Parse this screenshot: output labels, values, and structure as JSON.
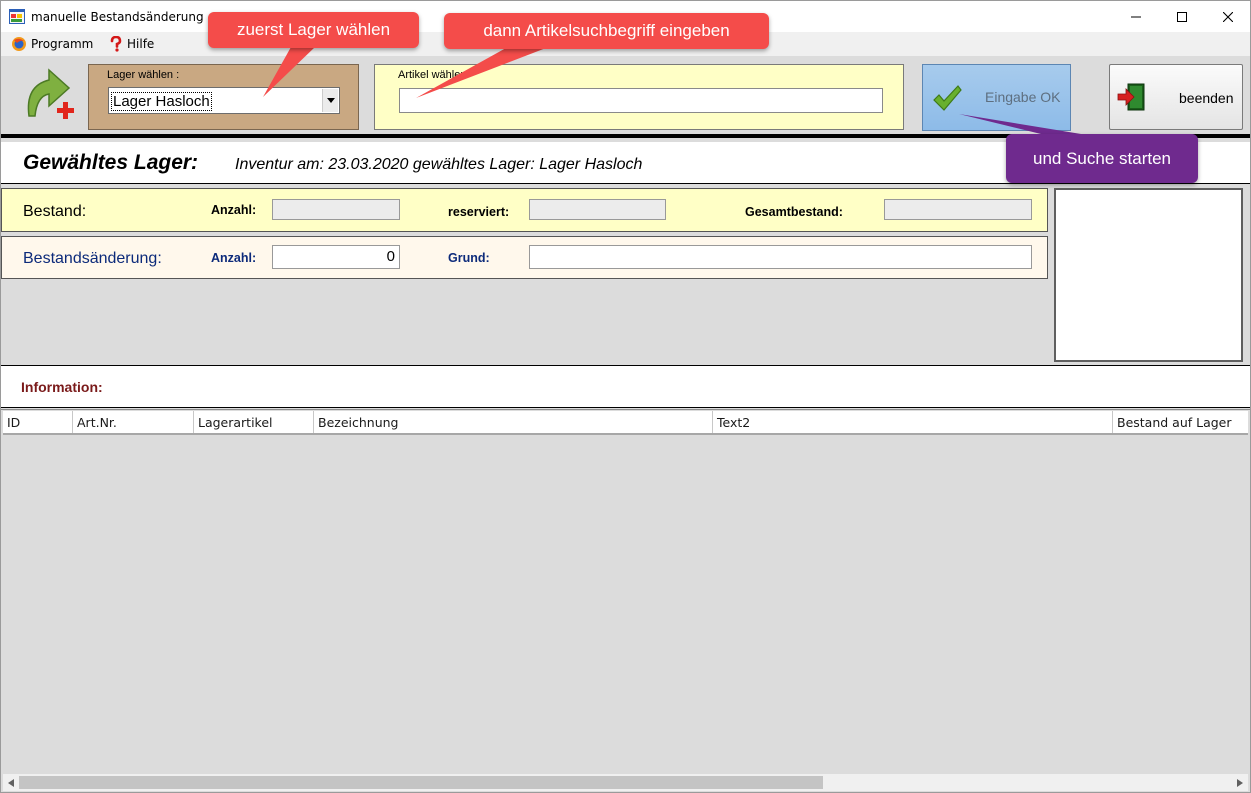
{
  "window": {
    "title": "manuelle Bestandsänderung"
  },
  "menu": {
    "items": [
      {
        "label": "Programm",
        "icon": "firefox-like-app-icon"
      },
      {
        "label": "Hilfe",
        "icon": "red-question-icon"
      }
    ]
  },
  "toolbar": {
    "lager_label": "Lager wählen :",
    "lager_value": "Lager Hasloch",
    "artikel_label": "Artikel wählen",
    "artikel_value": "",
    "ok_label": "Eingabe OK",
    "exit_label": "beenden"
  },
  "selected": {
    "title": "Gewähltes Lager:",
    "info": "Inventur am: 23.03.2020  gewähltes Lager:  Lager Hasloch"
  },
  "bestand": {
    "title": "Bestand:",
    "anzahl_label": "Anzahl:",
    "reserviert_label": "reserviert:",
    "gesamt_label": "Gesamtbestand:",
    "anzahl_value": "",
    "reserviert_value": "",
    "gesamt_value": ""
  },
  "aenderung": {
    "title": "Bestandsänderung:",
    "anzahl_label": "Anzahl:",
    "anzahl_value": "0",
    "grund_label": "Grund:",
    "grund_value": ""
  },
  "information": {
    "label": "Information:"
  },
  "grid": {
    "columns": [
      "ID",
      "Art.Nr.",
      "Lagerartikel",
      "Bezeichnung",
      "Text2",
      "Bestand auf Lager"
    ],
    "rows": []
  },
  "callouts": {
    "c1": "zuerst Lager wählen",
    "c2": "dann Artikelsuchbegriff eingeben",
    "c3": "und Suche starten"
  },
  "colors": {
    "lager_bg": "#c9a882",
    "artikel_bg": "#ffffc6",
    "ok_bg": "#9fc6ec",
    "callout_red": "#f44c4a",
    "callout_purple": "#6f2a8e",
    "navy_text": "#0c2a7a",
    "info_text": "#7a1a1a"
  }
}
